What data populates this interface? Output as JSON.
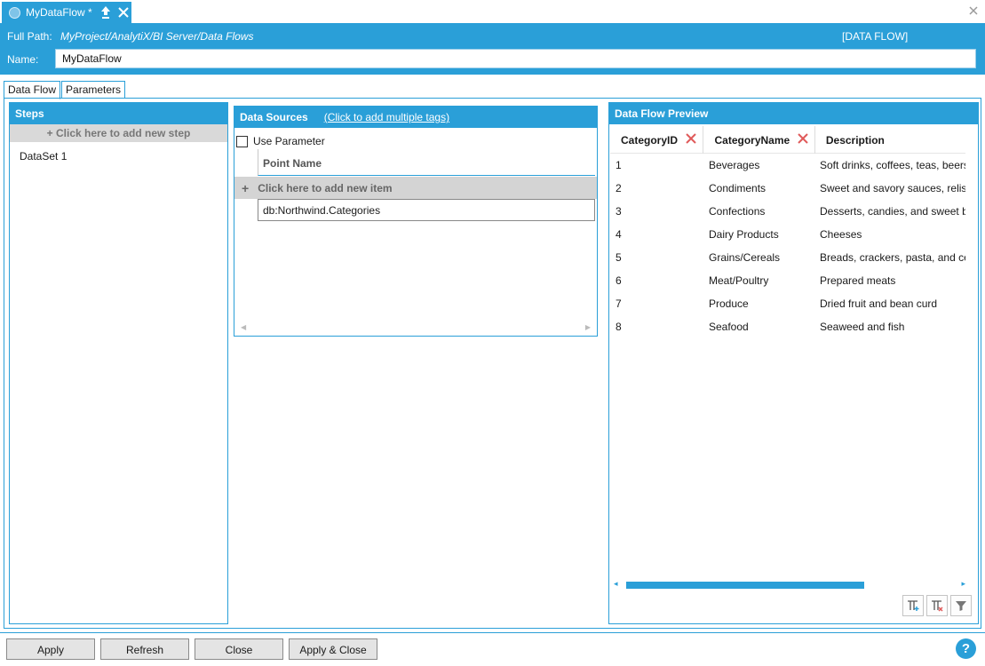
{
  "tab": {
    "title": "MyDataFlow *"
  },
  "header": {
    "full_path_label": "Full Path:",
    "full_path_value": "MyProject/AnalytiX/BI Server/Data Flows",
    "type_tag": "[DATA FLOW]",
    "name_label": "Name:",
    "name_value": "MyDataFlow"
  },
  "page_tabs": [
    "Data Flow",
    "Parameters"
  ],
  "steps": {
    "title": "Steps",
    "add_label": "+ Click here to add new step",
    "items": [
      {
        "name": "DataSet",
        "index": "1"
      }
    ]
  },
  "sources": {
    "title": "Data Sources",
    "link": "(Click to add multiple tags)",
    "use_parameter": "Use Parameter",
    "column": "Point Name",
    "add_label": "Click here to add new item",
    "items": [
      "db:Northwind.Categories"
    ]
  },
  "preview": {
    "title": "Data Flow Preview",
    "columns": [
      "CategoryID",
      "CategoryName",
      "Description"
    ],
    "rows": [
      [
        "1",
        "Beverages",
        "Soft drinks, coffees, teas, beers,"
      ],
      [
        "2",
        "Condiments",
        "Sweet and savory sauces, relish"
      ],
      [
        "3",
        "Confections",
        "Desserts, candies, and sweet br"
      ],
      [
        "4",
        "Dairy Products",
        "Cheeses"
      ],
      [
        "5",
        "Grains/Cereals",
        "Breads, crackers, pasta, and cer"
      ],
      [
        "6",
        "Meat/Poultry",
        "Prepared meats"
      ],
      [
        "7",
        "Produce",
        "Dried fruit and bean curd"
      ],
      [
        "8",
        "Seafood",
        "Seaweed and fish"
      ]
    ]
  },
  "footer": {
    "apply": "Apply",
    "refresh": "Refresh",
    "close": "Close",
    "apply_close": "Apply & Close",
    "help": "?"
  },
  "colors": {
    "accent": "#2a9fd8",
    "remove": "#e05a5a"
  }
}
